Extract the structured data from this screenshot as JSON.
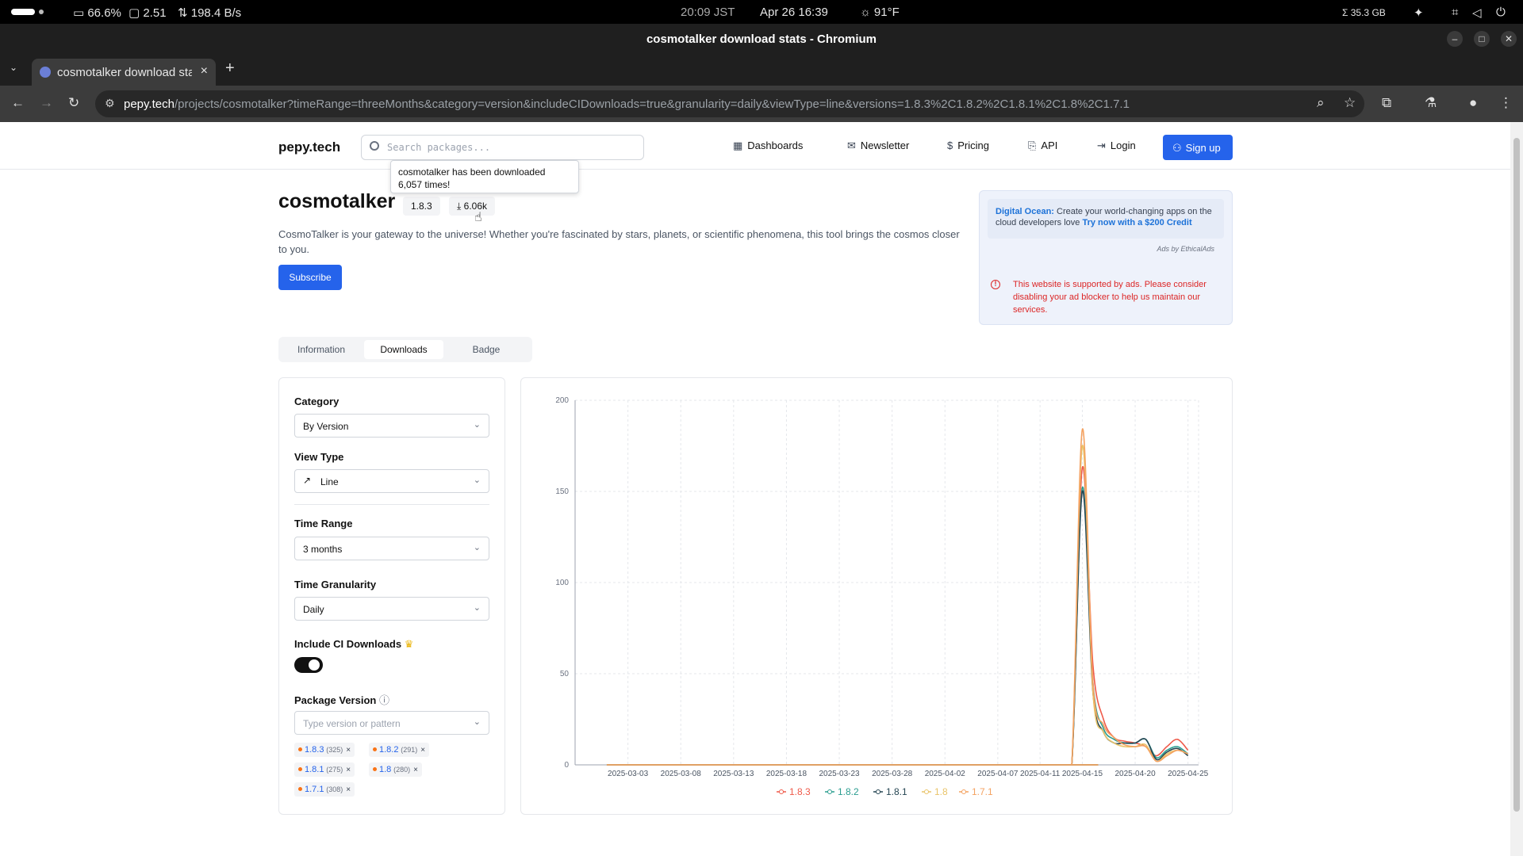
{
  "os_bar": {
    "battery": "66.6%",
    "load": "2.51",
    "net": "198.4 B/s",
    "time_tz": "20:09 JST",
    "datetime": "Apr 26  16:39",
    "weather": "91°F",
    "disk": "Σ 35.3 GB"
  },
  "window": {
    "title": "cosmotalker download stats - Chromium"
  },
  "browser": {
    "tab_title": "cosmotalker download stats",
    "url_host": "pepy.tech",
    "url_path": "/projects/cosmotalker?timeRange=threeMonths&category=version&includeCIDownloads=true&granularity=daily&viewType=line&versions=1.8.3%2C1.8.2%2C1.8.1%2C1.8%2C1.7.1"
  },
  "site": {
    "logo": "pepy.tech",
    "search_placeholder": "Search packages...",
    "nav": {
      "dashboards": "Dashboards",
      "newsletter": "Newsletter",
      "pricing": "Pricing",
      "api": "API",
      "login": "Login",
      "signup": "Sign up"
    }
  },
  "tooltip": "cosmotalker has been downloaded 6,057 times!",
  "package": {
    "name": "cosmotalker",
    "version": "1.8.3",
    "downloads": "6.06k",
    "description": "CosmoTalker is your gateway to the universe! Whether you're fascinated by stars, planets, or scientific phenomena, this tool brings the cosmos closer to you.",
    "subscribe": "Subscribe"
  },
  "ad": {
    "brand": "Digital Ocean:",
    "text": "Create your world-changing apps on the cloud developers love",
    "cta": "Try now with a $200 Credit",
    "by": "Ads by EthicalAds",
    "warning": "This website is supported by ads. Please consider disabling your ad blocker to help us maintain our services."
  },
  "page_tabs": [
    "Information",
    "Downloads",
    "Badge"
  ],
  "filters": {
    "category_label": "Category",
    "category_value": "By Version",
    "viewtype_label": "View Type",
    "viewtype_value": "Line",
    "timerange_label": "Time Range",
    "timerange_value": "3 months",
    "granularity_label": "Time Granularity",
    "granularity_value": "Daily",
    "ci_label": "Include CI Downloads",
    "ci_enabled": true,
    "version_label": "Package Version",
    "version_placeholder": "Type version or pattern",
    "chips": [
      {
        "version": "1.8.3",
        "count": "(325)"
      },
      {
        "version": "1.8.2",
        "count": "(291)"
      },
      {
        "version": "1.8.1",
        "count": "(275)"
      },
      {
        "version": "1.8",
        "count": "(280)"
      },
      {
        "version": "1.7.1",
        "count": "(308)"
      }
    ]
  },
  "chart_data": {
    "type": "line",
    "ylim": [
      0,
      200
    ],
    "yticks": [
      0,
      50,
      100,
      150,
      200
    ],
    "xticks": [
      "2025-03-03",
      "2025-03-08",
      "2025-03-13",
      "2025-03-18",
      "2025-03-23",
      "2025-03-28",
      "2025-04-02",
      "2025-04-07",
      "2025-04-11",
      "2025-04-15",
      "2025-04-20",
      "2025-04-25"
    ],
    "grid": true,
    "legend_position": "bottom",
    "x": [
      "2025-04-13",
      "2025-04-14",
      "2025-04-15",
      "2025-04-16",
      "2025-04-17",
      "2025-04-18",
      "2025-04-19",
      "2025-04-20",
      "2025-04-21",
      "2025-04-22",
      "2025-04-23",
      "2025-04-24",
      "2025-04-25"
    ],
    "series": [
      {
        "name": "1.8.3",
        "color": "#ef5a4a",
        "values": [
          0,
          0,
          163,
          55,
          25,
          15,
          13,
          12,
          10,
          5,
          10,
          14,
          8
        ]
      },
      {
        "name": "1.8.2",
        "color": "#2a9d8f",
        "values": [
          0,
          0,
          152,
          45,
          20,
          14,
          12,
          12,
          14,
          4,
          8,
          10,
          6
        ]
      },
      {
        "name": "1.8.1",
        "color": "#264653",
        "values": [
          0,
          0,
          150,
          40,
          18,
          12,
          12,
          12,
          14,
          3,
          7,
          9,
          5
        ]
      },
      {
        "name": "1.8",
        "color": "#e9c46a",
        "values": [
          0,
          0,
          175,
          40,
          18,
          12,
          10,
          10,
          11,
          2,
          6,
          8,
          6
        ]
      },
      {
        "name": "1.7.1",
        "color": "#f4a261",
        "values": [
          0,
          0,
          184,
          45,
          22,
          15,
          11,
          10,
          10,
          2,
          5,
          8,
          6
        ]
      }
    ]
  }
}
